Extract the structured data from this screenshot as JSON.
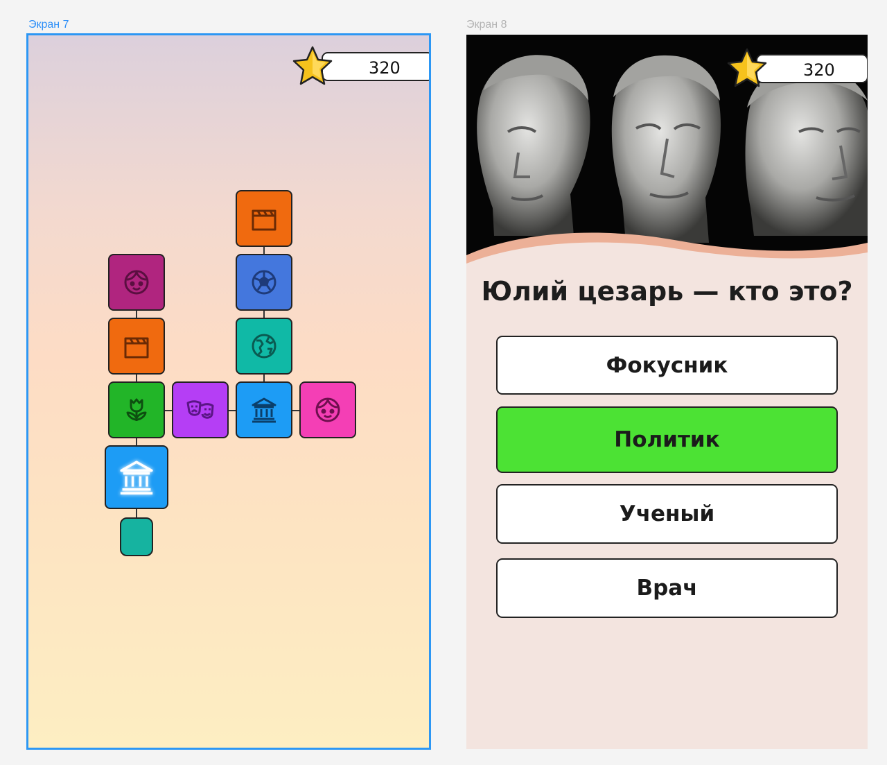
{
  "screens": [
    {
      "label": "Экран 7"
    },
    {
      "label": "Экран 8"
    }
  ],
  "map_screen": {
    "score": "320",
    "tiles": [
      {
        "category": "cinema",
        "icon": "clapperboard-icon",
        "color": "#f06a0f"
      },
      {
        "category": "sport",
        "icon": "soccer-ball-icon",
        "color": "#4477dd"
      },
      {
        "category": "geography",
        "icon": "globe-icon",
        "color": "#10b9a6"
      },
      {
        "category": "person",
        "icon": "face-icon",
        "color": "#b0257f"
      },
      {
        "category": "cinema",
        "icon": "clapperboard-icon",
        "color": "#f06a0f"
      },
      {
        "category": "nature",
        "icon": "tulip-icon",
        "color": "#22b528"
      },
      {
        "category": "theater",
        "icon": "theater-masks-icon",
        "color": "#b53ef5"
      },
      {
        "category": "history",
        "icon": "museum-icon",
        "color": "#1d9cf5"
      },
      {
        "category": "person",
        "icon": "face-icon",
        "color": "#f43fb5"
      },
      {
        "category": "history",
        "icon": "museum-icon",
        "color": "#1d9cf5",
        "active": true
      },
      {
        "category": "locked",
        "icon": "",
        "color": "#16b3a0"
      }
    ]
  },
  "quiz_screen": {
    "score": "320",
    "question": "Юлий цезарь — кто это?",
    "answers": [
      {
        "label": "Фокусник",
        "correct": false
      },
      {
        "label": "Политик",
        "correct": true
      },
      {
        "label": "Ученый",
        "correct": false
      },
      {
        "label": "Врач",
        "correct": false
      }
    ],
    "colors": {
      "correct": "#4ce234",
      "accent": "#ecb097"
    }
  }
}
